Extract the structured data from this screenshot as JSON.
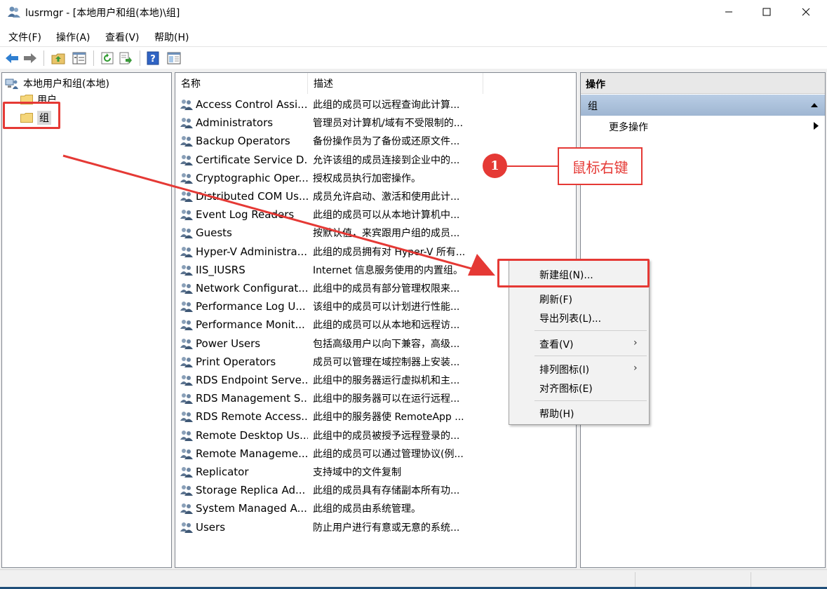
{
  "window": {
    "title": "lusrmgr - [本地用户和组(本地)\\组]",
    "minimize": "—",
    "maximize": "☐",
    "close": "✕"
  },
  "menu": [
    "文件(F)",
    "操作(A)",
    "查看(V)",
    "帮助(H)"
  ],
  "toolbar": [
    "back-icon",
    "forward-icon",
    "up-folder-icon",
    "show-hide-tree-icon",
    "refresh-icon",
    "export-list-icon",
    "help-icon",
    "properties-icon"
  ],
  "tree": {
    "root": "本地用户和组(本地)",
    "users": "用户",
    "groups": "组"
  },
  "list": {
    "columns": [
      "名称",
      "描述"
    ],
    "rows": [
      {
        "name": "Access Control Assi...",
        "desc": "此组的成员可以远程查询此计算..."
      },
      {
        "name": "Administrators",
        "desc": "管理员对计算机/域有不受限制的..."
      },
      {
        "name": "Backup Operators",
        "desc": "备份操作员为了备份或还原文件..."
      },
      {
        "name": "Certificate Service D...",
        "desc": "允许该组的成员连接到企业中的..."
      },
      {
        "name": "Cryptographic Oper...",
        "desc": "授权成员执行加密操作。"
      },
      {
        "name": "Distributed COM Us...",
        "desc": "成员允许启动、激活和使用此计..."
      },
      {
        "name": "Event Log Readers",
        "desc": "此组的成员可以从本地计算机中..."
      },
      {
        "name": "Guests",
        "desc": "按默认值，来宾跟用户组的成员..."
      },
      {
        "name": "Hyper-V Administra...",
        "desc": "此组的成员拥有对 Hyper-V 所有..."
      },
      {
        "name": "IIS_IUSRS",
        "desc": "Internet 信息服务使用的内置组。"
      },
      {
        "name": "Network Configurat...",
        "desc": "此组中的成员有部分管理权限来..."
      },
      {
        "name": "Performance Log U...",
        "desc": "该组中的成员可以计划进行性能..."
      },
      {
        "name": "Performance Monit...",
        "desc": "此组的成员可以从本地和远程访..."
      },
      {
        "name": "Power Users",
        "desc": "包括高级用户以向下兼容，高级..."
      },
      {
        "name": "Print Operators",
        "desc": "成员可以管理在域控制器上安装..."
      },
      {
        "name": "RDS Endpoint Serve...",
        "desc": "此组中的服务器运行虚拟机和主..."
      },
      {
        "name": "RDS Management S...",
        "desc": "此组中的服务器可以在运行远程..."
      },
      {
        "name": "RDS Remote Access...",
        "desc": "此组中的服务器使 RemoteApp ..."
      },
      {
        "name": "Remote Desktop Us...",
        "desc": "此组中的成员被授予远程登录的..."
      },
      {
        "name": "Remote Manageme...",
        "desc": "此组的成员可以通过管理协议(例..."
      },
      {
        "name": "Replicator",
        "desc": "支持域中的文件复制"
      },
      {
        "name": "Storage Replica Ad...",
        "desc": "此组的成员具有存储副本所有功..."
      },
      {
        "name": "System Managed A...",
        "desc": "此组的成员由系统管理。"
      },
      {
        "name": "Users",
        "desc": "防止用户进行有意或无意的系统..."
      }
    ]
  },
  "actions": {
    "title": "操作",
    "section": "组",
    "more": "更多操作"
  },
  "context_menu": {
    "new_group": "新建组(N)...",
    "refresh": "刷新(F)",
    "export": "导出列表(L)...",
    "view": "查看(V)",
    "arrange": "排列图标(I)",
    "align": "对齐图标(E)",
    "help": "帮助(H)"
  },
  "annotation": {
    "step_number": "1",
    "callout_text": "鼠标右键",
    "accent_color": "#e53935"
  }
}
